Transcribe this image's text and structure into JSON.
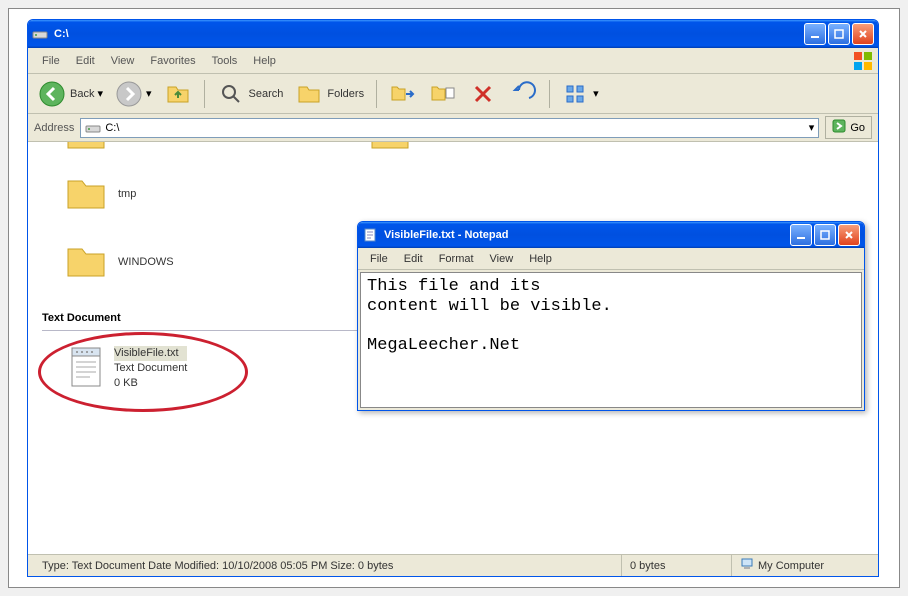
{
  "explorer": {
    "title": "C:\\",
    "menubar": [
      "File",
      "Edit",
      "View",
      "Favorites",
      "Tools",
      "Help"
    ],
    "toolbar": {
      "back_label": "Back",
      "search_label": "Search",
      "folders_label": "Folders"
    },
    "addressbar": {
      "label": "Address",
      "value": "C:\\",
      "go_label": "Go"
    },
    "folders": [
      {
        "name": "tmp"
      },
      {
        "name": "WINDOWS"
      }
    ],
    "group_header": "Text Document",
    "file": {
      "name": "VisibleFile.txt",
      "type": "Text Document",
      "size": "0 KB"
    },
    "statusbar": {
      "details": "Type: Text Document Date Modified: 10/10/2008 05:05 PM Size: 0 bytes",
      "bytes": "0 bytes",
      "location": "My Computer"
    }
  },
  "notepad": {
    "title": "VisibleFile.txt - Notepad",
    "menubar": [
      "File",
      "Edit",
      "Format",
      "View",
      "Help"
    ],
    "content": "This file and its\ncontent will be visible.\n\nMegaLeecher.Net"
  }
}
